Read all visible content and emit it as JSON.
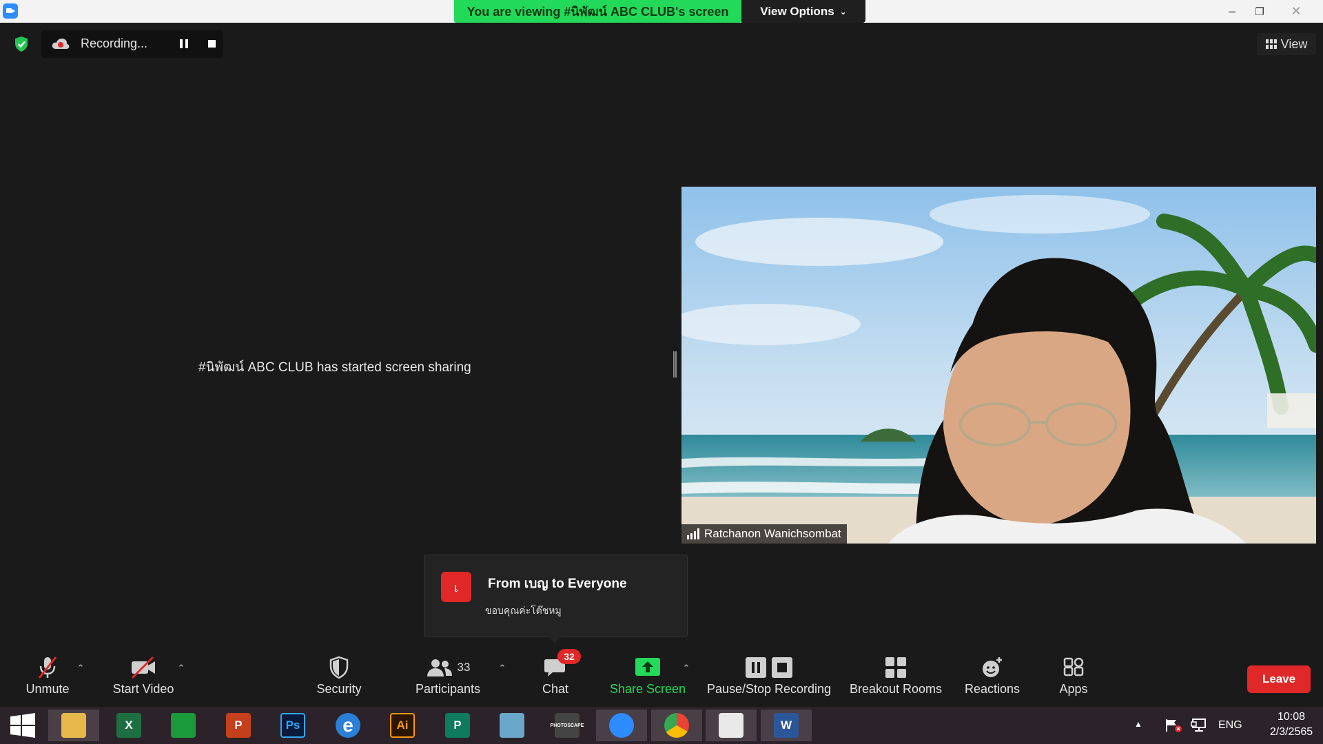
{
  "window": {
    "viewing_banner": "You are viewing #นิพัฒน์ ABC CLUB's screen",
    "view_options_label": "View Options",
    "minimize": "–",
    "restore": "❐",
    "close": "✕"
  },
  "recording": {
    "status": "Recording..."
  },
  "view_button_label": "View",
  "main": {
    "share_message": "#นิพัฒน์ ABC CLUB has started screen sharing"
  },
  "video": {
    "participant_name": "Ratchanon Wanichsombat"
  },
  "chat_toast": {
    "avatar_letter": "เ",
    "title": "From เบญ to Everyone",
    "message": "ขอบคุณค่ะโต๊ชหมู"
  },
  "toolbar": {
    "unmute": "Unmute",
    "start_video": "Start Video",
    "security": "Security",
    "participants": "Participants",
    "participants_count": "33",
    "chat": "Chat",
    "chat_badge": "32",
    "share_screen": "Share Screen",
    "pause_stop_recording": "Pause/Stop Recording",
    "breakout_rooms": "Breakout Rooms",
    "reactions": "Reactions",
    "apps": "Apps",
    "leave": "Leave"
  },
  "taskbar": {
    "apps": [
      {
        "name": "file-explorer",
        "label": "",
        "color": "#e8b84a"
      },
      {
        "name": "excel",
        "label": "X",
        "color": "#1d6f42"
      },
      {
        "name": "store",
        "label": "",
        "color": "#1a9a3a"
      },
      {
        "name": "powerpoint",
        "label": "P",
        "color": "#c4401c"
      },
      {
        "name": "photoshop",
        "label": "Ps",
        "color": "#0b1a3a"
      },
      {
        "name": "internet-explorer",
        "label": "e",
        "color": "#2a7fd6"
      },
      {
        "name": "illustrator",
        "label": "Ai",
        "color": "#2a1500"
      },
      {
        "name": "publisher",
        "label": "P",
        "color": "#0e7a5e"
      },
      {
        "name": "notepad",
        "label": "",
        "color": "#6aa7c8"
      },
      {
        "name": "photoscape",
        "label": "PHOTOSCAPE",
        "color": "#444"
      },
      {
        "name": "zoom",
        "label": "",
        "color": "#2d8cff"
      },
      {
        "name": "chrome",
        "label": "",
        "color": "#ea4335"
      },
      {
        "name": "photos",
        "label": "",
        "color": "#e9e9e9"
      },
      {
        "name": "word",
        "label": "W",
        "color": "#2b579a"
      }
    ],
    "language": "ENG",
    "time": "10:08",
    "date": "2/3/2565"
  },
  "colors": {
    "banner_green": "#23d959",
    "share_green": "#23d959",
    "leave_red": "#e02828",
    "badge_red": "#e02828"
  }
}
